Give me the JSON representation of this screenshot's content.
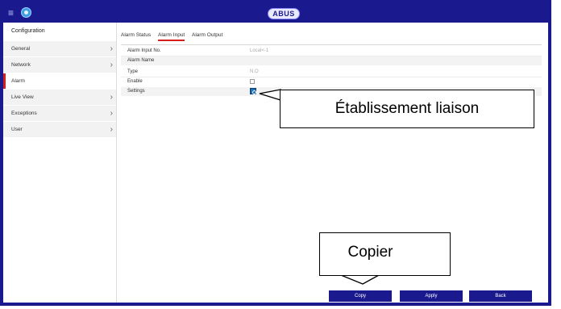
{
  "header": {
    "logo": "ABUS",
    "menu_icon": "hamburger-icon",
    "home_icon": "home-icon"
  },
  "sidebar": {
    "title": "Configuration",
    "items": [
      {
        "label": "General",
        "has_chevron": true
      },
      {
        "label": "Network",
        "has_chevron": true
      },
      {
        "label": "Alarm",
        "active": true
      },
      {
        "label": "Live View",
        "has_chevron": true
      },
      {
        "label": "Exceptions",
        "has_chevron": true
      },
      {
        "label": "User",
        "has_chevron": true
      }
    ]
  },
  "tabs": [
    {
      "label": "Alarm Status"
    },
    {
      "label": "Alarm Input",
      "active": true
    },
    {
      "label": "Alarm Output"
    }
  ],
  "form": {
    "alarm_input_no": {
      "label": "Alarm Input No.",
      "value": "Local<-1"
    },
    "alarm_name": {
      "label": "Alarm Name",
      "value": ""
    },
    "type": {
      "label": "Type",
      "value": "N.O"
    },
    "enable": {
      "label": "Enable",
      "checked": false
    },
    "settings": {
      "label": "Settings",
      "icon": "settings-icon"
    }
  },
  "buttons": {
    "copy": "Copy",
    "apply": "Apply",
    "back": "Back"
  },
  "annotations": {
    "settings_callout": "Établissement liaison",
    "copy_callout": "Copier"
  },
  "colors": {
    "frame": "#1a1a8e",
    "accent_red": "#d51f1f",
    "button": "#1a1a8e"
  }
}
